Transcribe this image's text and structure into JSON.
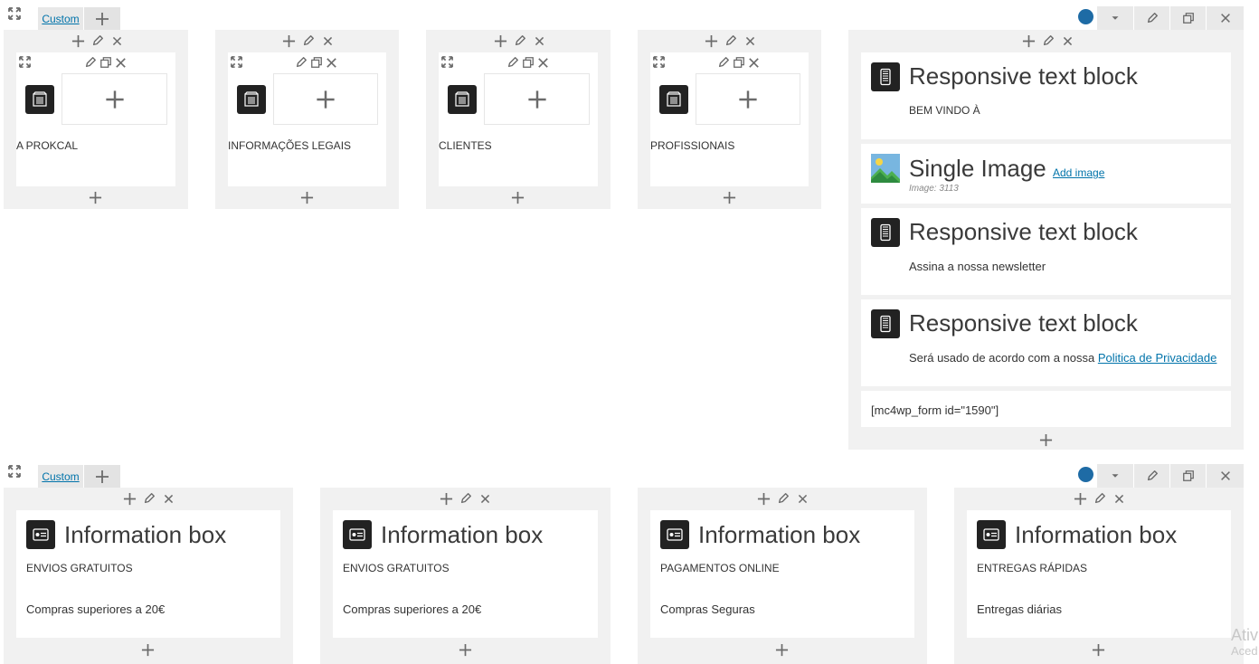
{
  "rows": [
    {
      "layout_label": "Custom",
      "columns_small": [
        {
          "text": "A PROKCAL"
        },
        {
          "text": "INFORMAÇÕES LEGAIS"
        },
        {
          "text": "CLIENTES"
        },
        {
          "text": "PROFISSIONAIS"
        }
      ],
      "right_column": {
        "blocks": [
          {
            "type": "responsive",
            "title": "Responsive text block",
            "text": "BEM VINDO À"
          },
          {
            "type": "image",
            "title": "Single Image",
            "add_label": "Add image",
            "meta": "Image: 3113"
          },
          {
            "type": "responsive",
            "title": "Responsive text block",
            "text": "Assina a nossa newsletter"
          },
          {
            "type": "responsive",
            "title": "Responsive text block",
            "text_prefix": "Será usado de acordo com a nossa ",
            "link_text": "Politica de Privacidade"
          },
          {
            "type": "shortcode",
            "text": "[mc4wp_form id=\"1590\"]"
          }
        ]
      }
    },
    {
      "layout_label": "Custom",
      "info_boxes": [
        {
          "title": "Information box",
          "heading": "ENVIOS GRATUITOS",
          "text": "Compras superiores a 20€"
        },
        {
          "title": "Information box",
          "heading": "ENVIOS GRATUITOS",
          "text": "Compras superiores a 20€"
        },
        {
          "title": "Information box",
          "heading": "PAGAMENTOS ONLINE",
          "text": "Compras Seguras"
        },
        {
          "title": "Information box",
          "heading": "ENTREGAS RÁPIDAS",
          "text": "Entregas diárias"
        }
      ]
    }
  ],
  "watermark": {
    "line1": "Ativ",
    "line2": "Aced"
  },
  "colors": {
    "accent": "#1e6ba5",
    "link": "#0073aa",
    "column_bg": "#f1f1f1",
    "icon_bg": "#222222"
  }
}
